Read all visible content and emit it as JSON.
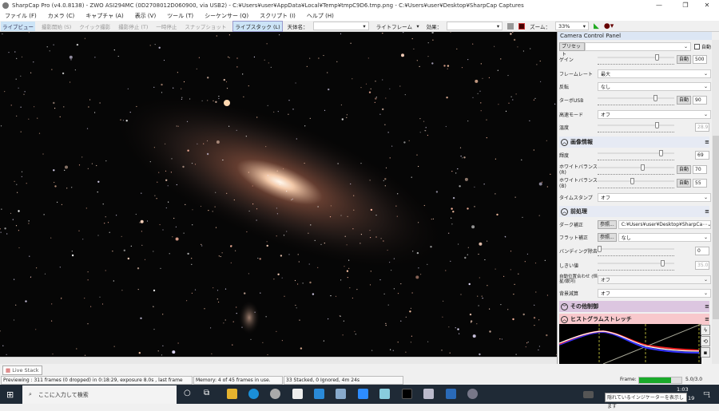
{
  "window": {
    "title": "SharpCap Pro (v4.0.8138) - ZWO ASI294MC (0D2708012D060900, via USB2) - C:¥Users¥user¥AppData¥Local¥Temp¥tmpC9D6.tmp.png - C:¥Users¥user¥Desktop¥SharpCap Captures",
    "minimize": "—",
    "maximize": "❐",
    "close": "✕"
  },
  "menu": [
    "ファイル (F)",
    "カメラ (C)",
    "キャプチャ (A)",
    "表示 (V)",
    "ツール (T)",
    "シーケンサー (Q)",
    "スクリプト (I)",
    "ヘルプ (H)"
  ],
  "toolbar": {
    "live_view": "ライブビュー",
    "start_capture": "撮影開始 (S)",
    "quick_capture": "クイック撮影",
    "stop_capture": "撮影停止 (T)",
    "pause": "一時停止",
    "snapshot": "スナップショット",
    "live_stack": "ライブスタック (L)",
    "target_label": "天体名：",
    "target_value": "",
    "frame_type": "ライトフレーム",
    "effect_label": "効果：",
    "effect_value": "",
    "zoom_label": "ズーム：",
    "zoom_value": "33%"
  },
  "panel": {
    "title": "Camera Control Panel",
    "preset_label": "プリセット",
    "preset_auto": "自動",
    "gain": {
      "label": "ゲイン",
      "auto": "自動",
      "value": "500",
      "slider": 0.8
    },
    "framerate": {
      "label": "フレームレート",
      "value": "最大"
    },
    "flip": {
      "label": "反転",
      "value": "なし"
    },
    "turbo_usb": {
      "label": "ターボUSB",
      "auto": "自動",
      "value": "90",
      "slider": 0.78
    },
    "high_speed": {
      "label": "高速モード",
      "value": "オフ"
    },
    "temperature": {
      "label": "温度",
      "value": "28.9",
      "slider": 0.8
    },
    "image_section": "画像情報",
    "brightness": {
      "label": "輝度",
      "value": "69",
      "slider": 0.85
    },
    "wb_r": {
      "label": "ホワイトバランス(R)",
      "auto": "自動",
      "value": "70",
      "slider": 0.6
    },
    "wb_b": {
      "label": "ホワイトバランス(B)",
      "auto": "自動",
      "value": "55",
      "slider": 0.46
    },
    "timestamp": {
      "label": "タイムスタンプ",
      "value": "オフ"
    },
    "preprocess_section": "前処理",
    "dark": {
      "label": "ダーク補正",
      "browse": "参照...",
      "value": "C:¥Users¥user¥Desktop¥SharpCa⋯"
    },
    "flat": {
      "label": "フラット補正",
      "browse": "参照...",
      "value": "なし"
    },
    "banding": {
      "label": "バンディング除去",
      "value": "0",
      "slider": 0.0
    },
    "threshold": {
      "label": "しきい値",
      "value": "35.0",
      "slider": 0.88
    },
    "auto_align": {
      "label": "自動位置合わせ (恒星/銀河)",
      "value": "オフ"
    },
    "background": {
      "label": "背景減算",
      "value": "オフ"
    },
    "other_section": "その他制御",
    "histogram_section": "ヒストグラムストレッチ"
  },
  "tabs": {
    "live_stack": "Live Stack"
  },
  "status": {
    "preview": "Previewing : 311 frames (0 dropped) in 0:18:29, exposure 8.0s , last frame 9.3s",
    "memory": "Memory: 4 of 45 frames in use.",
    "stack": "33 Stacked, 0 Ignored, 4m 24s",
    "frame_label": "Frame:",
    "frame_value": "5.0/3.0",
    "frame_progress": 0.75
  },
  "taskbar": {
    "search_placeholder": "ここに入力して検索",
    "time": "1:03",
    "date": "19",
    "tooltip": "隠れているインジケーターを表示します",
    "notification_count": "1"
  }
}
